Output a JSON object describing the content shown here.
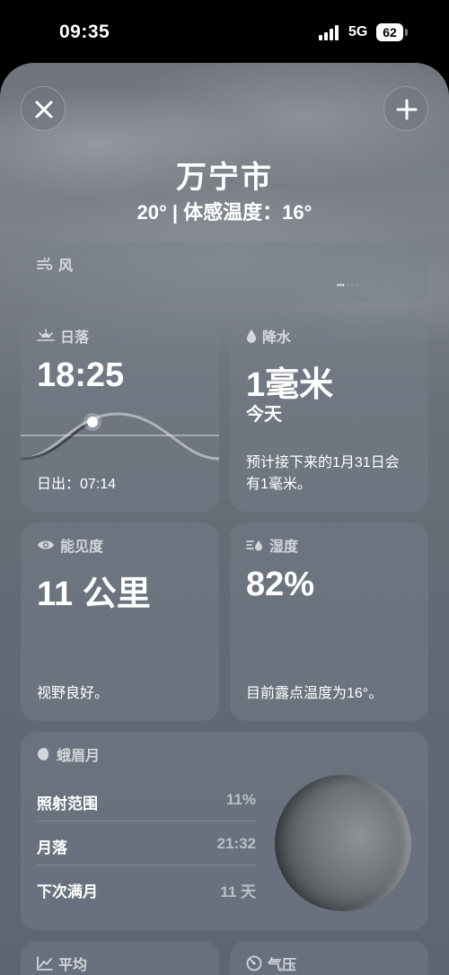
{
  "status_bar": {
    "time": "09:35",
    "network": "5G",
    "battery": "62"
  },
  "header": {
    "city": "万宁市",
    "subline": "20° | 体感温度：16°"
  },
  "wind": {
    "title": "风"
  },
  "sunset": {
    "title": "日落",
    "time": "18:25",
    "sunrise": "日出：07:14"
  },
  "precipitation": {
    "title": "降水",
    "amount": "1毫米",
    "period": "今天",
    "note": "预计接下来的1月31日会有1毫米。"
  },
  "visibility": {
    "title": "能见度",
    "value": "11 公里",
    "note": "视野良好。"
  },
  "humidity": {
    "title": "湿度",
    "value": "82%",
    "note": "目前露点温度为16°。"
  },
  "moon": {
    "title": "蛾眉月",
    "rows": [
      {
        "label": "照射范围",
        "value": "11%"
      },
      {
        "label": "月落",
        "value": "21:32"
      },
      {
        "label": "下次满月",
        "value": "11 天"
      }
    ]
  },
  "average": {
    "title": "平均"
  },
  "pressure": {
    "title": "气压"
  }
}
